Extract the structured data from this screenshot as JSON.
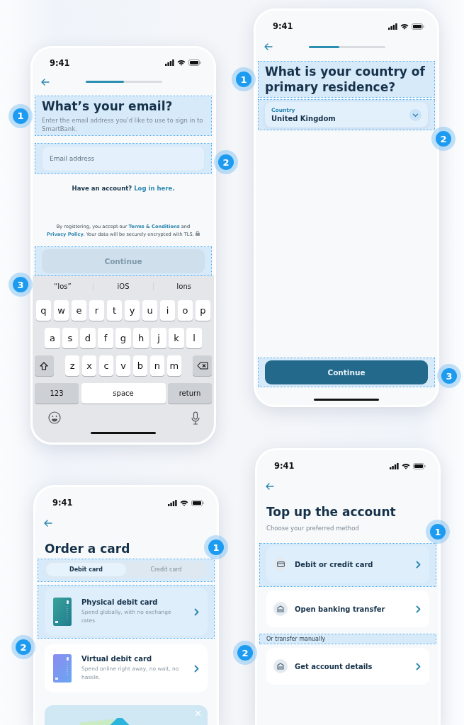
{
  "email_screen": {
    "time": "9:41",
    "progress": {
      "level": 0.5
    },
    "header": {
      "title": "What’s your email?",
      "subtitle": "Enter the email address you’d like to use to sign in to SmartBank.",
      "callout": "1"
    },
    "email_field": {
      "placeholder": "Email address",
      "callout": "2"
    },
    "account_prompt": {
      "text": "Have an account?",
      "link": "Log in here."
    },
    "legal": [
      {
        "kind": "text",
        "text": "By registering, you accept our "
      },
      {
        "kind": "link",
        "text": "Terms & Conditions"
      },
      {
        "kind": "text",
        "text": " and "
      },
      {
        "kind": "link",
        "text": "Privacy Policy"
      },
      {
        "kind": "text",
        "text": ". Your data will be securely encrypted with TLS."
      }
    ],
    "continue": {
      "label": "Continue",
      "disabled": true,
      "callout": "3"
    },
    "keyboard": {
      "suggestions": [
        "“Ios”",
        "iOS",
        "Ions"
      ],
      "rows": [
        [
          "q",
          "w",
          "e",
          "r",
          "t",
          "y",
          "u",
          "i",
          "o",
          "p"
        ],
        [
          "a",
          "s",
          "d",
          "f",
          "g",
          "h",
          "j",
          "k",
          "l"
        ],
        [
          "z",
          "x",
          "c",
          "v",
          "b",
          "n",
          "m"
        ]
      ],
      "numbers_key": "123",
      "space_key": "space",
      "return_key": "return"
    }
  },
  "country_screen": {
    "time": "9:41",
    "progress": {
      "level": 0.4
    },
    "header": {
      "title": "What is your country of primary residence?",
      "callout": "1"
    },
    "country_select": {
      "label": "Country",
      "value": "United Kingdom",
      "callout": "2"
    },
    "continue": {
      "label": "Continue",
      "disabled": false,
      "callout": "3"
    }
  },
  "card_screen": {
    "time": "9:41",
    "title": "Order a card",
    "tabs": [
      {
        "label": "Debit card",
        "selected": true
      },
      {
        "label": "Credit card",
        "selected": false
      }
    ],
    "tabs_callout": "1",
    "options": [
      {
        "kind": "physical",
        "title": "Physical debit card",
        "description": "Spend globally, with no exchange rates",
        "callout": "2"
      },
      {
        "kind": "virtual",
        "title": "Virtual debit card",
        "description": "Spend online right away, no wait, no hassle."
      }
    ]
  },
  "topup_screen": {
    "time": "9:41",
    "title": "Top up the account",
    "subtitle": "Choose your preferred method",
    "methods": [
      {
        "kind": "card",
        "label": "Debit or credit card",
        "callout": "1"
      },
      {
        "kind": "bank",
        "label": "Open banking transfer"
      }
    ],
    "manual_label": {
      "text": "Or transfer manually",
      "callout": "2"
    },
    "manual_methods": [
      {
        "kind": "bank",
        "label": "Get account details"
      }
    ]
  }
}
